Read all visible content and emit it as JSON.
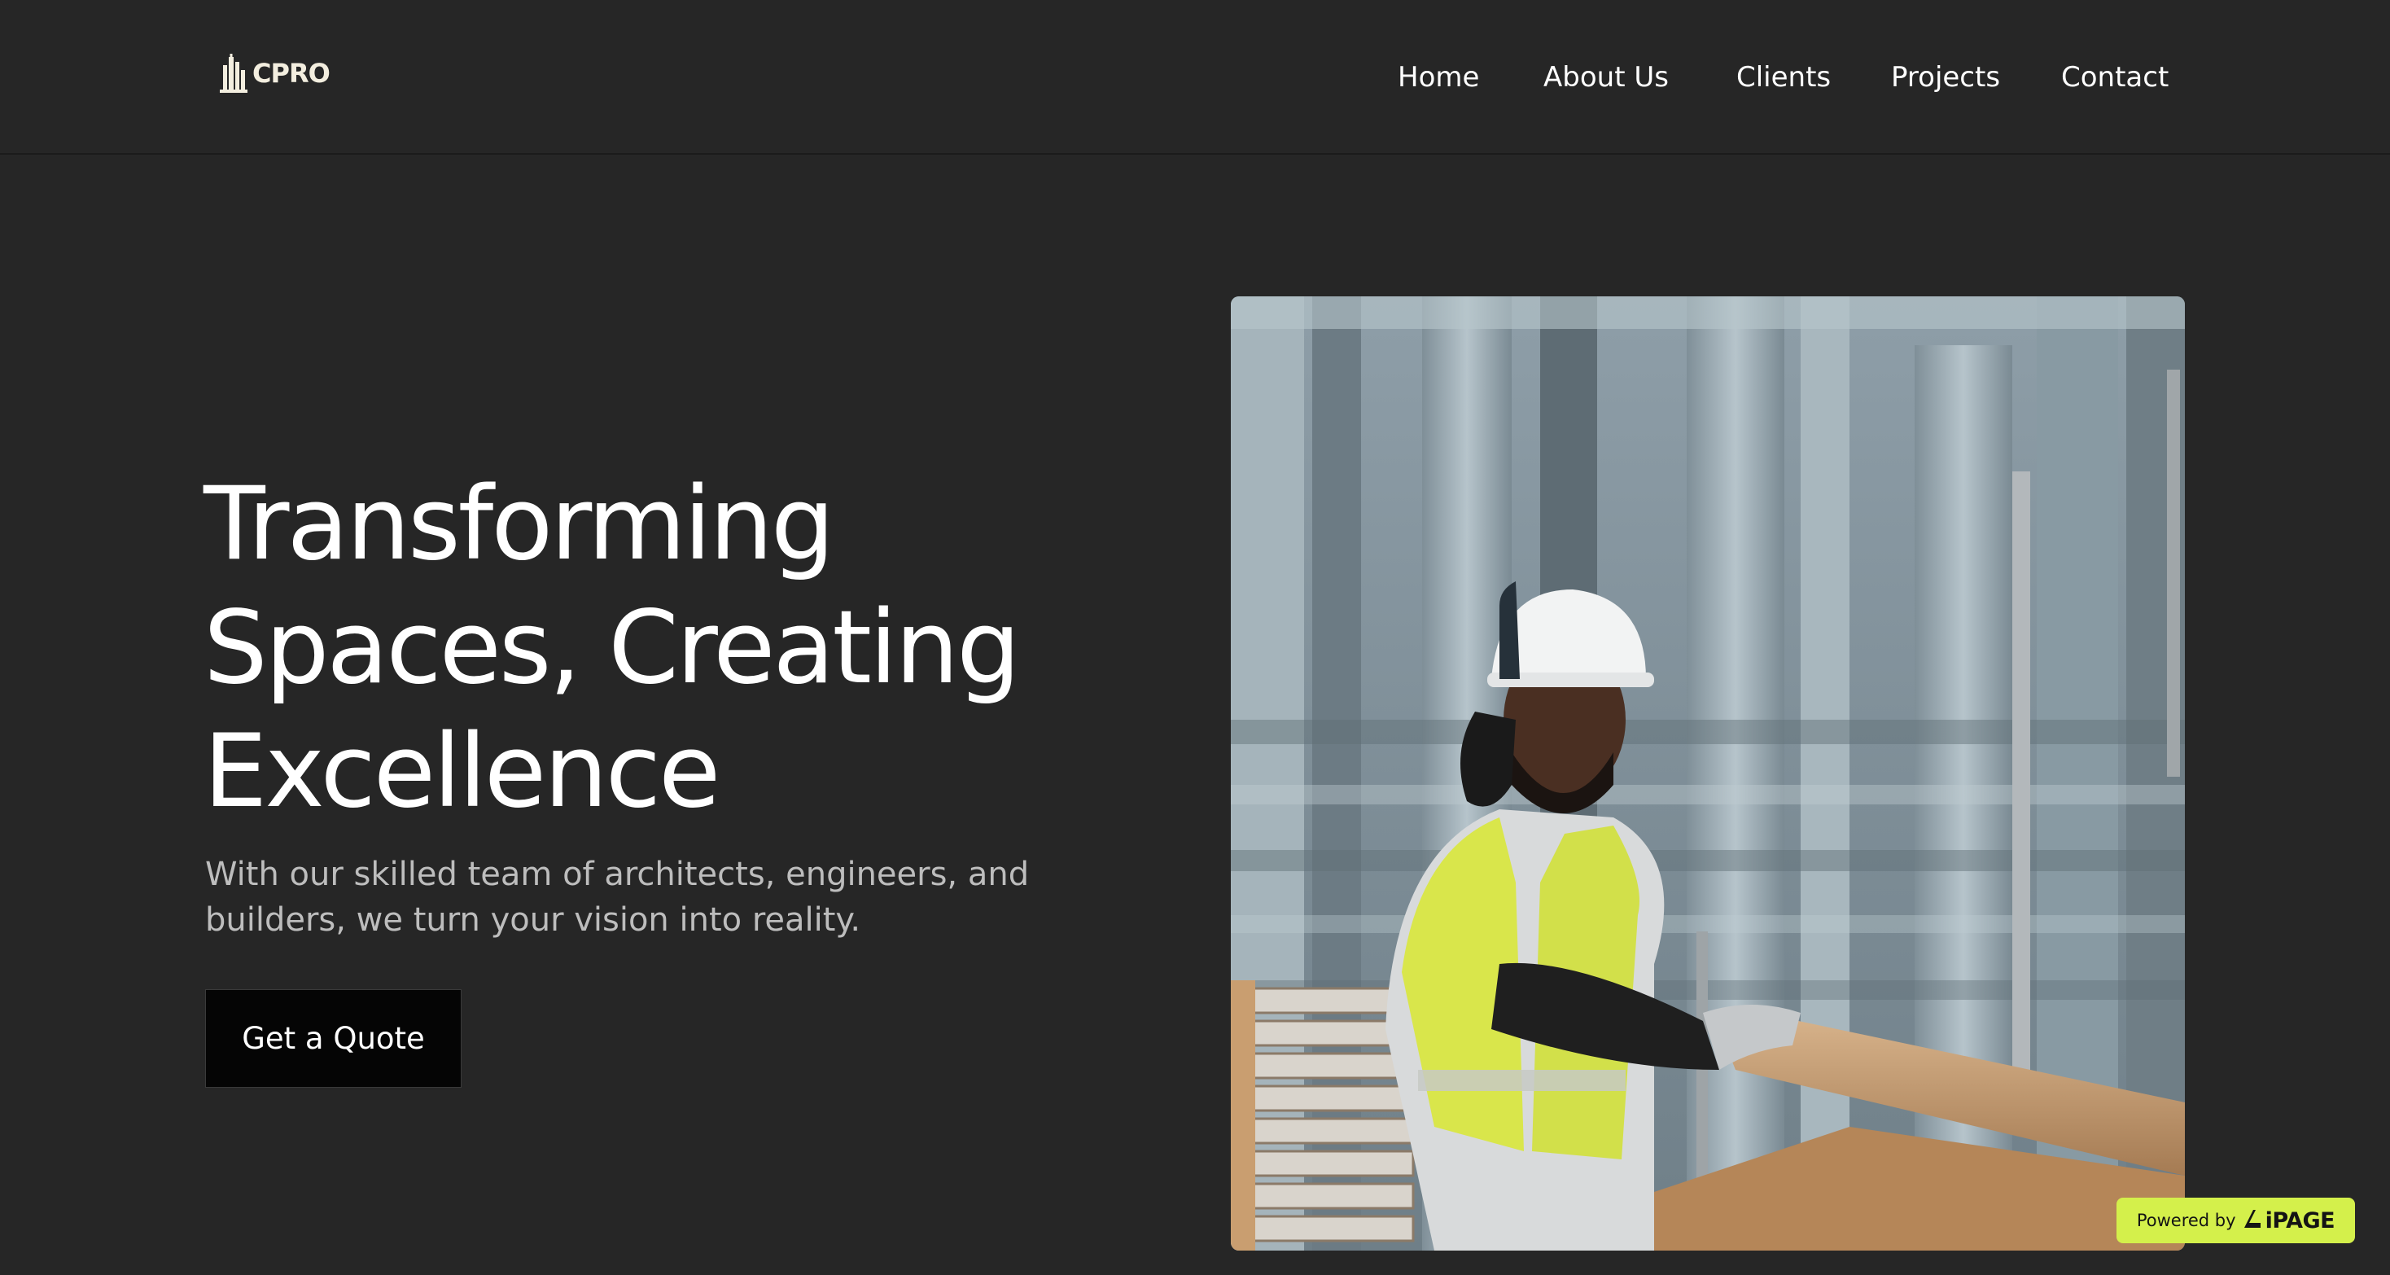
{
  "brand": {
    "logo_text": "CPRO",
    "logo_icon": "building-icon",
    "logo_color": "#f3eedf"
  },
  "nav": {
    "items": [
      {
        "label": "Home"
      },
      {
        "label": "About Us"
      },
      {
        "label": "Clients"
      },
      {
        "label": "Projects"
      },
      {
        "label": "Contact"
      }
    ]
  },
  "hero": {
    "title_lines": [
      "Transforming",
      "Spaces, Creating",
      "Excellence"
    ],
    "subtitle": "With our skilled team of architects, engineers, and builders, we turn your vision into reality.",
    "cta_label": "Get a Quote",
    "image_icon": "construction-worker-photo"
  },
  "badge": {
    "powered_label": "Powered by",
    "brand_label": "iPAGE",
    "color": "#d4f04b"
  },
  "colors": {
    "background": "#262626",
    "cta_background": "#050505",
    "subtitle": "#bdbdbd"
  }
}
